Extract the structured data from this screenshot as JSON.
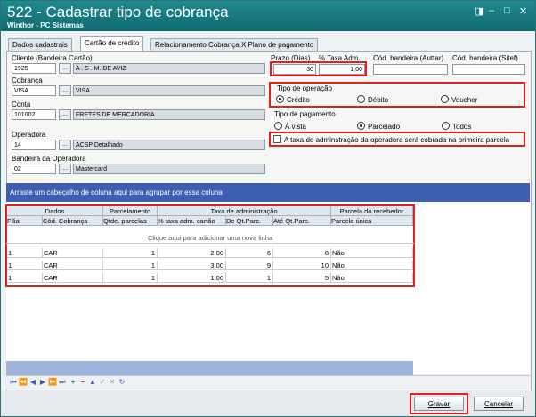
{
  "window": {
    "title": "522 - Cadastrar tipo de cobrança",
    "subtitle": "Winthor - PC Sistemas",
    "controls": [
      "◨",
      "–",
      "□",
      "✕"
    ]
  },
  "tabs": [
    {
      "label": "Dados cadastrais"
    },
    {
      "label": "Cartão de crédito"
    },
    {
      "label": "Relacionamento Cobrança X Plano de pagamento"
    }
  ],
  "form": {
    "cliente": {
      "label": "Cliente (Bandeira Cartão)",
      "code": "1925",
      "name": "A . S .  M. DE AVIZ"
    },
    "cobranca": {
      "label": "Cobrança",
      "code": "VISA",
      "name": "VISA"
    },
    "conta": {
      "label": "Conta",
      "code": "101002",
      "name": "FRETES DE MERCADORIA"
    },
    "operadora": {
      "label": "Operadora",
      "code": "14",
      "name": "ACSP Detalhado"
    },
    "bandeira": {
      "label": "Bandeira da Operadora",
      "code": "02",
      "name": "Mastercard"
    },
    "browse_label": "...",
    "prazo": {
      "label": "Prazo (Dias)",
      "value": "30"
    },
    "taxa": {
      "label": "% Taxa Adm.",
      "value": "1,00"
    },
    "auttar": {
      "label": "Cód. bandeira (Auttar)",
      "value": ""
    },
    "sitef": {
      "label": "Cód. bandeira (Sitef)",
      "value": ""
    },
    "tipo_operacao": {
      "label": "Tipo de operação",
      "options": [
        "Crédito",
        "Débito",
        "Voucher"
      ],
      "selected": "Crédito"
    },
    "tipo_pagamento": {
      "label": "Tipo de pagamento",
      "options": [
        "À vista",
        "Parcelado",
        "Todos"
      ],
      "selected": "Parcelado"
    },
    "checkbox_taxa": {
      "label": "A taxa de adminstração da operadora será cobrada na primeira parcela",
      "checked": false
    }
  },
  "grid": {
    "group_hint": "Arraste um cabeçalho de coluna aqui para agrupar por essa coluna",
    "band_headers": [
      "Dados",
      "Parcelamento",
      "Taxa de administração",
      "Parcela do recebedor"
    ],
    "columns": [
      "Filial",
      "Cód. Cobrança",
      "Qtde. parcelas",
      "% taxa adm. cartão",
      "De Qt.Parc.",
      "Até Qt.Parc.",
      "Parcela única"
    ],
    "new_row_hint": "Clique aqui para adicionar uma nova linha",
    "rows": [
      [
        "1",
        "CAR",
        "1",
        "2,00",
        "6",
        "8",
        "Não"
      ],
      [
        "1",
        "CAR",
        "1",
        "3,00",
        "9",
        "10",
        "Não"
      ],
      [
        "1",
        "CAR",
        "1",
        "1,00",
        "1",
        "5",
        "Não"
      ]
    ]
  },
  "navigator": [
    "⏮",
    "⏪",
    "◀",
    "▶",
    "⏩",
    "⏭",
    "+",
    "−",
    "▲",
    "✓",
    "✕",
    "↻"
  ],
  "buttons": {
    "save": "Gravar",
    "cancel": "Cancelar"
  },
  "colors": {
    "title_bar": "#15797e",
    "highlight": "#e0201c",
    "group_bar": "#3c5fb4"
  }
}
